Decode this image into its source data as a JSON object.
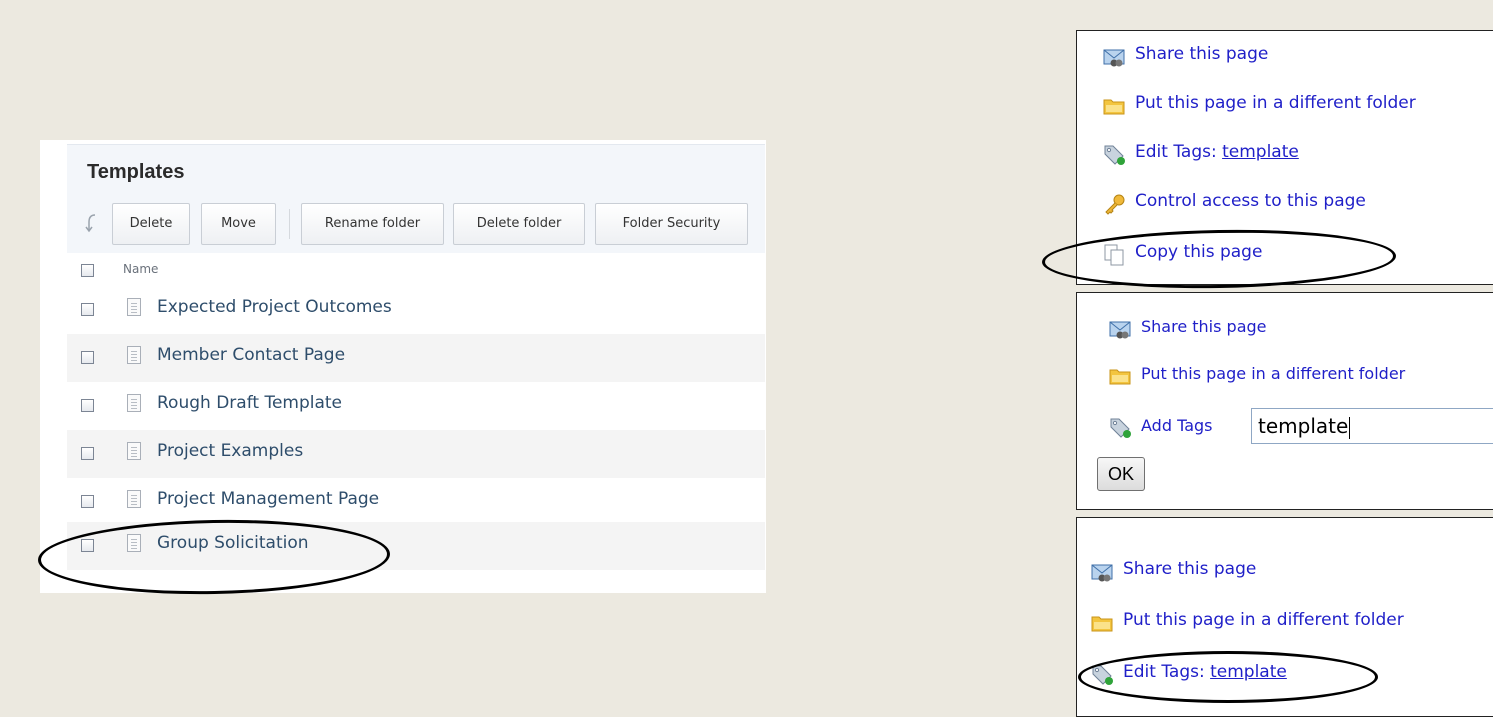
{
  "templates": {
    "title": "Templates",
    "toolbar": {
      "delete": "Delete",
      "move": "Move",
      "rename_folder": "Rename folder",
      "delete_folder": "Delete folder",
      "folder_security": "Folder Security"
    },
    "column_name": "Name",
    "rows": [
      {
        "label": "Expected Project Outcomes"
      },
      {
        "label": "Member Contact Page"
      },
      {
        "label": "Rough Draft Template"
      },
      {
        "label": "Project Examples"
      },
      {
        "label": "Project Management Page"
      },
      {
        "label": "Group Solicitation"
      }
    ]
  },
  "panel_a": {
    "share": "Share this page",
    "move_folder": "Put this page in a different folder",
    "edit_tags_prefix": "Edit Tags: ",
    "edit_tags_link": "template",
    "control_access": "Control access to this page",
    "copy_page": "Copy this page"
  },
  "panel_b": {
    "share": "Share this page",
    "move_folder": "Put this page in a different folder",
    "add_tags_label": "Add Tags",
    "tag_input_value": "template",
    "ok": "OK"
  },
  "panel_c": {
    "share": "Share this page",
    "move_folder": "Put this page in a different folder",
    "edit_tags_prefix": "Edit Tags: ",
    "edit_tags_link": "template"
  },
  "icons": {
    "share": "share-envelope-icon",
    "folder": "folder-icon",
    "tag": "tag-icon",
    "key": "key-icon",
    "copy": "copy-pages-icon",
    "document": "document-icon",
    "undo": "undo-arrow-icon"
  },
  "colors": {
    "link": "#1F1FC8",
    "row_text": "#2E4D6B",
    "background": "#ECE9E0"
  }
}
